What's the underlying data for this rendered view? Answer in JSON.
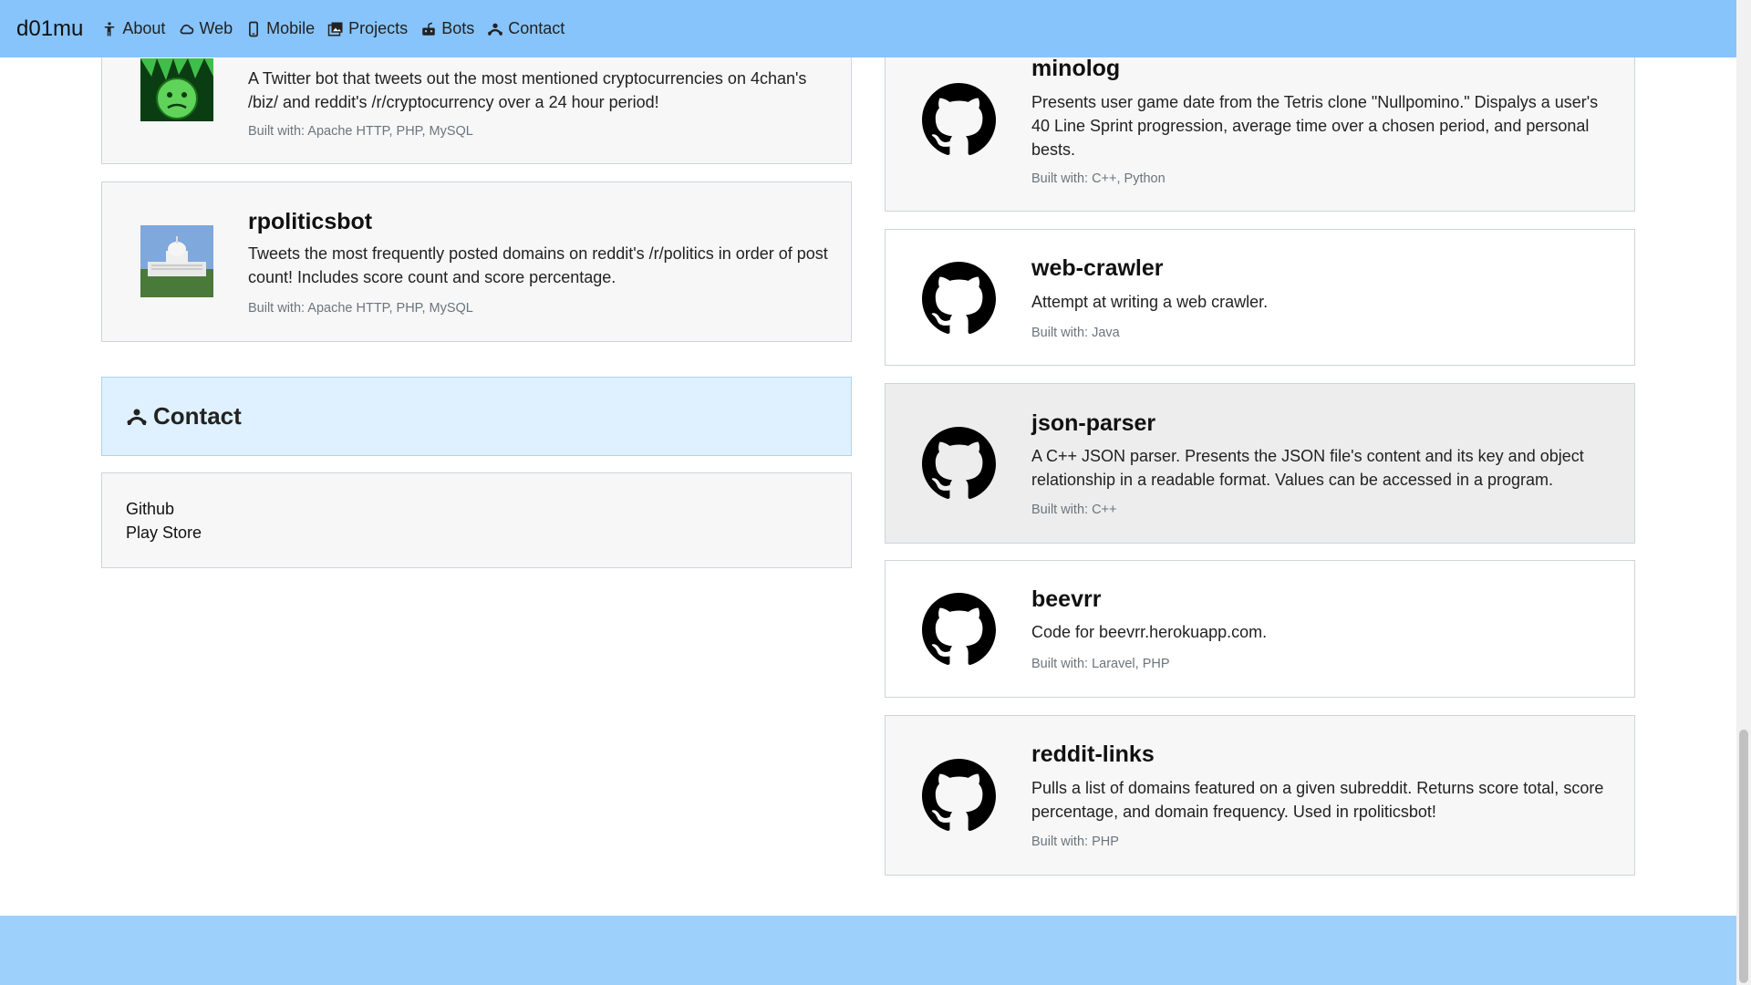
{
  "nav": {
    "brand": "d01mu",
    "items": [
      {
        "label": "About",
        "icon": "person-icon"
      },
      {
        "label": "Web",
        "icon": "cloud-icon"
      },
      {
        "label": "Mobile",
        "icon": "phone-icon"
      },
      {
        "label": "Projects",
        "icon": "images-icon"
      },
      {
        "label": "Bots",
        "icon": "robot-icon"
      },
      {
        "label": "Contact",
        "icon": "contact-icon"
      }
    ]
  },
  "bots": [
    {
      "name": "",
      "description": "A Twitter bot that tweets out the most mentioned cryptocurrencies on 4chan's /biz/ and reddit's /r/cryptocurrency over a 24 hour period!",
      "built": "Built with: Apache HTTP, PHP, MySQL"
    },
    {
      "name": "rpoliticsbot",
      "description": "Tweets the most frequently posted domains on reddit's /r/politics in order of post count! Includes score count and score percentage.",
      "built": "Built with: Apache HTTP, PHP, MySQL"
    }
  ],
  "contact": {
    "title": "Contact",
    "links": [
      "Github",
      "Play Store"
    ]
  },
  "projects": [
    {
      "name": "minolog",
      "description": "Presents user game date from the Tetris clone \"Nullpomino.\" Dispalys a user's 40 Line Sprint progression, average time over a chosen period, and personal bests.",
      "built": "Built with: C++, Python"
    },
    {
      "name": "web-crawler",
      "description": "Attempt at writing a web crawler.",
      "built": "Built with: Java"
    },
    {
      "name": "json-parser",
      "description": "A C++ JSON parser. Presents the JSON file's content and its key and object relationship in a readable format. Values can be accessed in a program.",
      "built": "Built with: C++"
    },
    {
      "name": "beevrr",
      "description": "Code for beevrr.herokuapp.com.",
      "built": "Built with: Laravel, PHP"
    },
    {
      "name": "reddit-links",
      "description": "Pulls a list of domains featured on a given subreddit. Returns score total, score percentage, and domain frequency. Used in rpoliticsbot!",
      "built": "Built with: PHP"
    }
  ],
  "colors": {
    "navbar": "#87c4fb",
    "footer": "#9ed0fc",
    "section_header": "#dff1fe"
  }
}
